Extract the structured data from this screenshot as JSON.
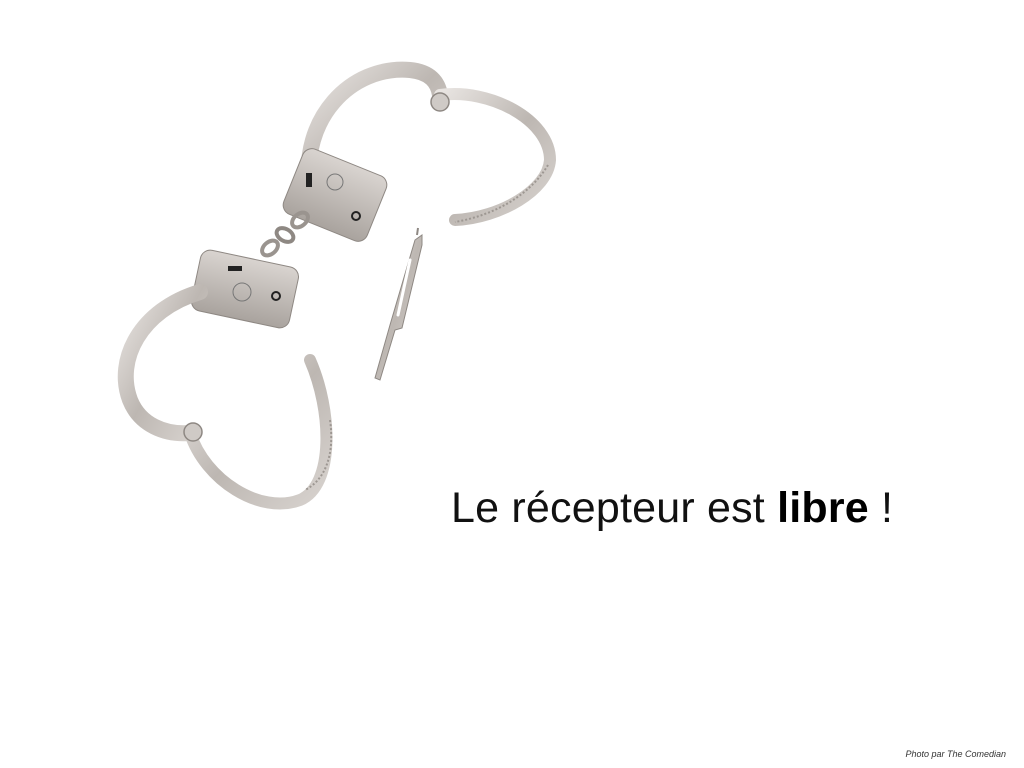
{
  "slide": {
    "headline": {
      "before": "Le récepteur est ",
      "emphasis": "libre",
      "after": " !"
    },
    "photo_credit": "Photo par The Comedian"
  },
  "image": {
    "subject": "open handcuffs with key",
    "icon": "handcuffs-icon"
  },
  "colors": {
    "background": "#ffffff",
    "text": "#111111",
    "metal": "#c9c4c0"
  }
}
